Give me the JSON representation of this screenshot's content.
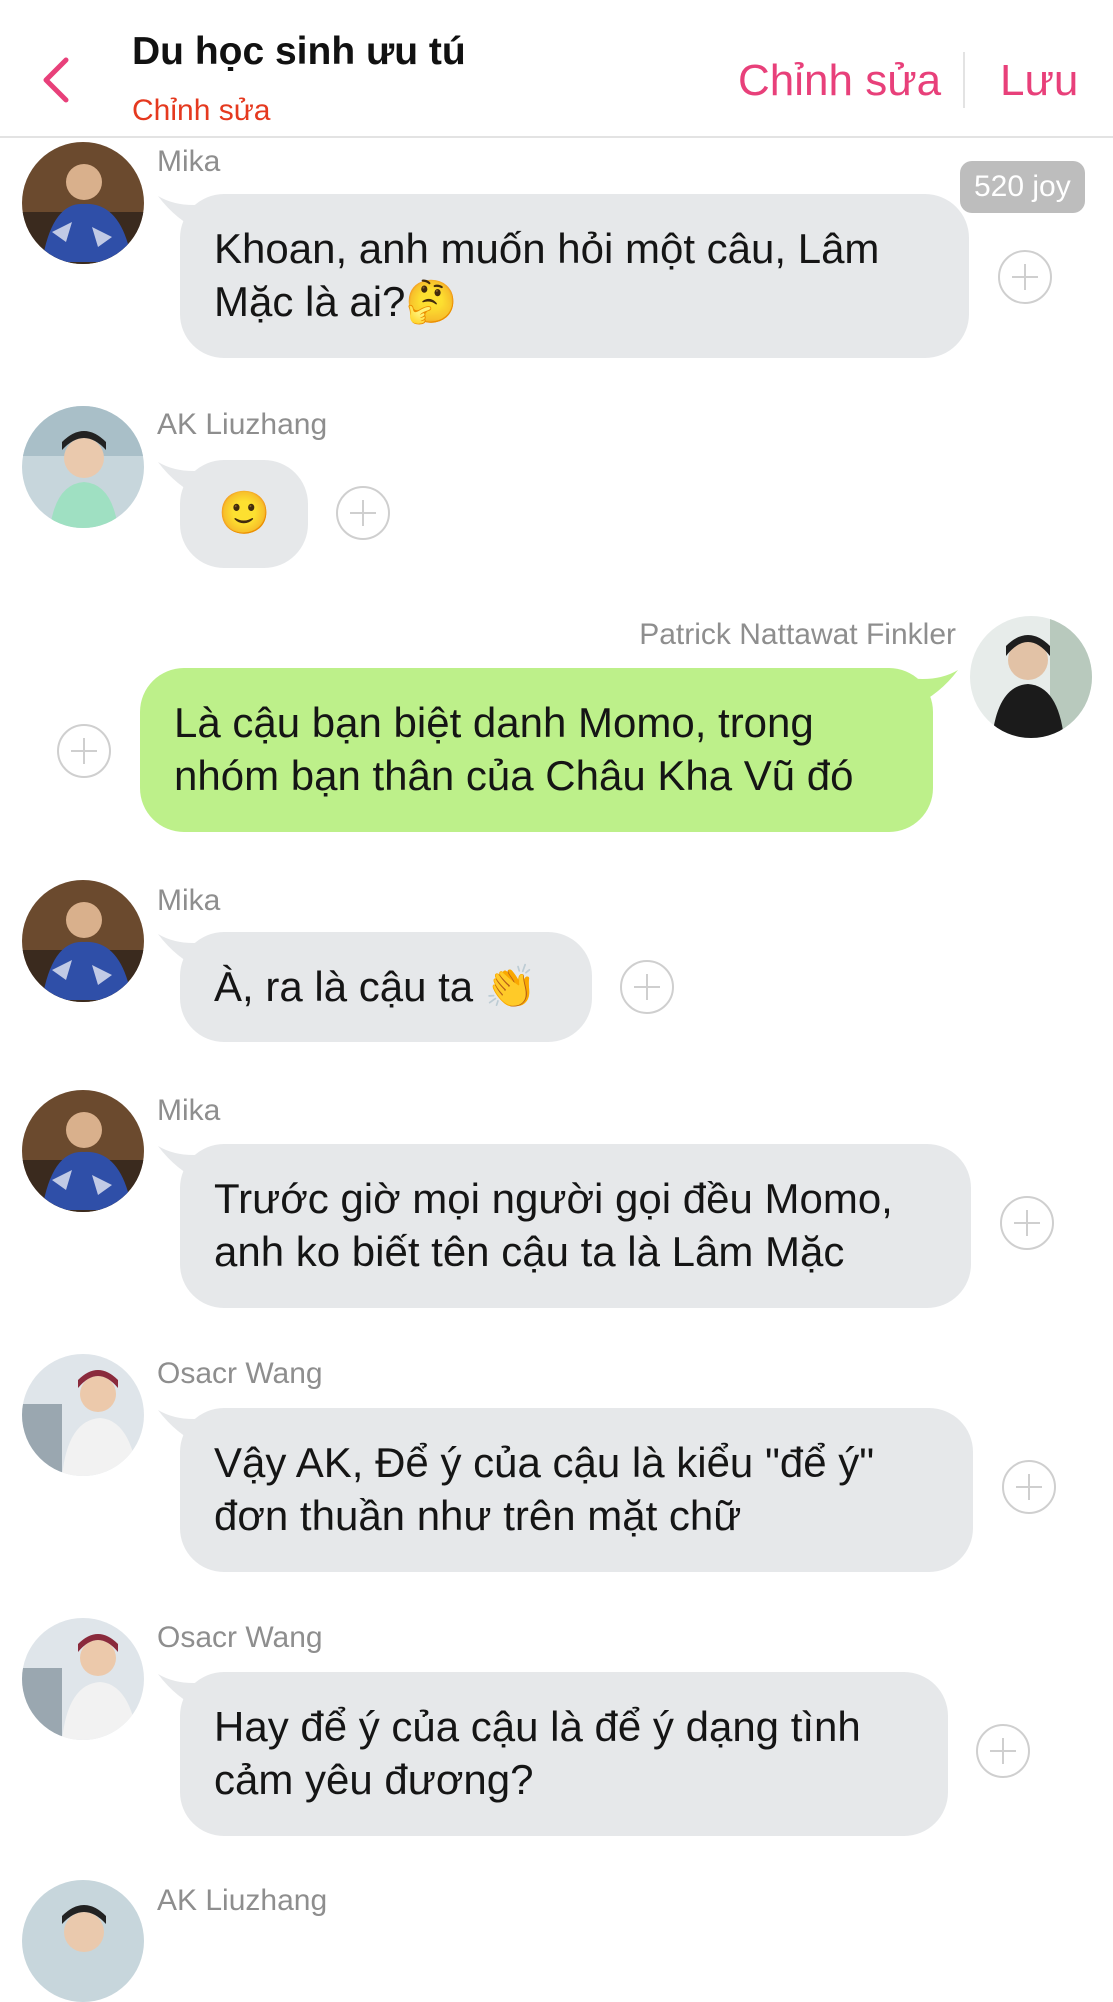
{
  "header": {
    "title": "Du học sinh ưu tú",
    "subtitle": "Chỉnh sửa",
    "edit_label": "Chỉnh sửa",
    "save_label": "Lưu",
    "back_icon": "chevron-left-icon",
    "accent_color": "#e8407a",
    "subtitle_color": "#e5391f"
  },
  "badge": "520 joy",
  "messages": [
    {
      "sender": "Mika",
      "text": "Khoan, anh muốn hỏi một câu, Lâm\nMặc là ai?🤔",
      "side": "left"
    },
    {
      "sender": "AK Liuzhang",
      "text": "🙂",
      "side": "left"
    },
    {
      "sender": "Patrick Nattawat Finkler",
      "text": "Là cậu bạn biệt danh Momo, trong\nnhóm bạn thân của Châu Kha Vũ đó",
      "side": "right"
    },
    {
      "sender": "Mika",
      "text": "À, ra là cậu ta 👏",
      "side": "left"
    },
    {
      "sender": "Mika",
      "text": "Trước giờ mọi người gọi đều Momo,\nanh ko biết tên cậu ta là Lâm Mặc",
      "side": "left"
    },
    {
      "sender": "Osacr Wang",
      "text": "Vậy AK, Để ý của cậu là kiểu  \"để ý\"\nđơn thuần như trên mặt chữ",
      "side": "left"
    },
    {
      "sender": "Osacr Wang",
      "text": "Hay để ý của cậu là để ý dạng tình\ncảm yêu đương?",
      "side": "left"
    },
    {
      "sender": "AK Liuzhang",
      "text": "",
      "side": "left"
    }
  ],
  "colors": {
    "bubble_gray": "#e6e8ea",
    "bubble_green": "#bdf08a",
    "sender_gray": "#8e8e8e"
  },
  "icons": {
    "add_reaction": "plus-circle-icon",
    "avatar": "avatar-photo"
  }
}
